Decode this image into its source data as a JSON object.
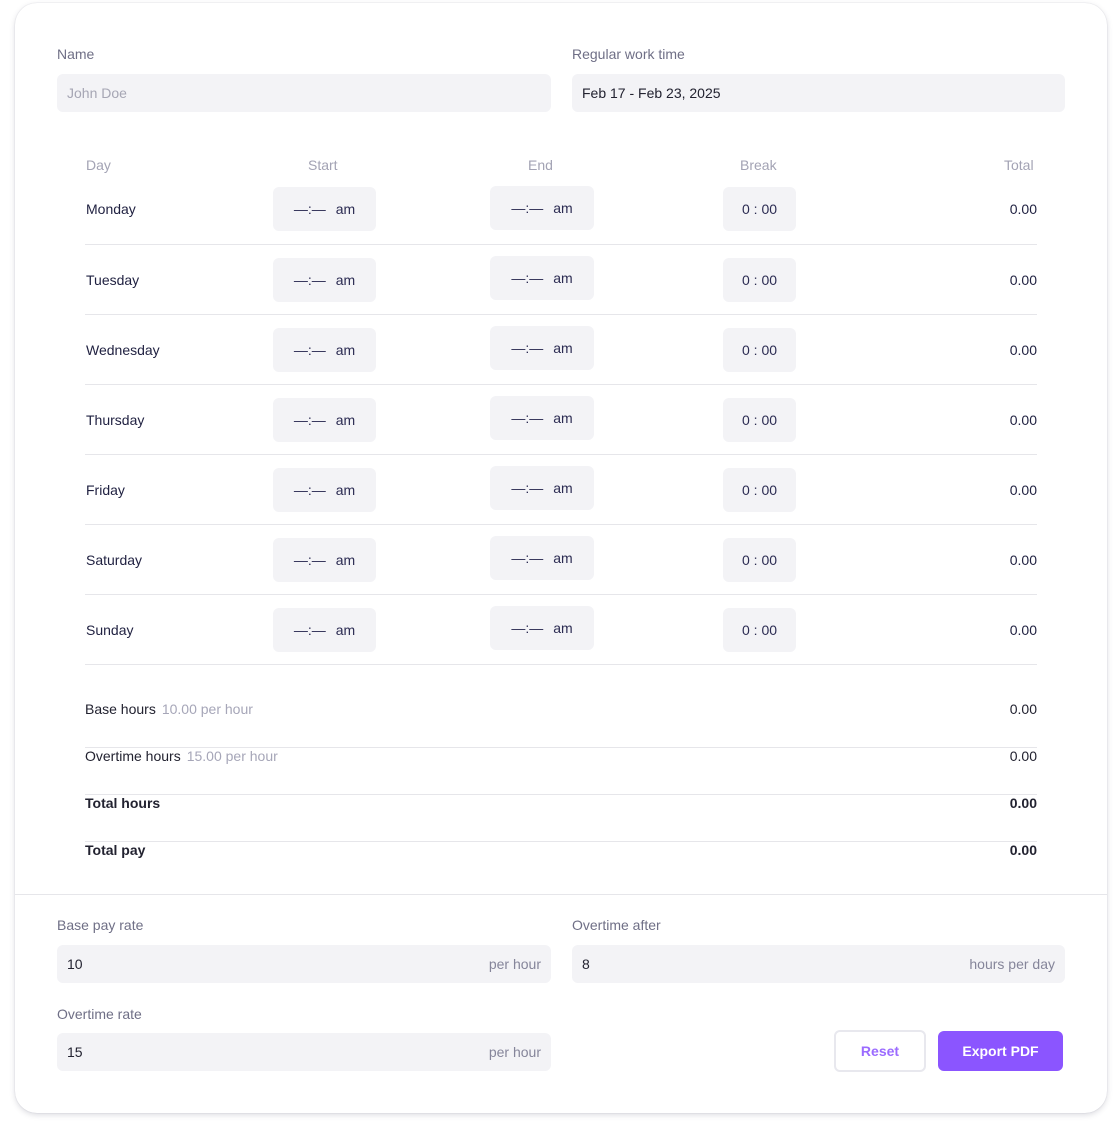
{
  "form": {
    "name": {
      "label": "Name",
      "placeholder": "John Doe",
      "value": ""
    },
    "work_time": {
      "label": "Regular work time",
      "value": "Feb 17 - Feb 23, 2025"
    }
  },
  "table": {
    "headers": {
      "day": "Day",
      "start": "Start",
      "end": "End",
      "break": "Break",
      "total": "Total"
    },
    "rows": [
      {
        "day": "Monday",
        "start_time": "—:—",
        "start_ampm": "am",
        "end_time": "—:—",
        "end_ampm": "am",
        "break": "0 : 00",
        "total": "0.00"
      },
      {
        "day": "Tuesday",
        "start_time": "—:—",
        "start_ampm": "am",
        "end_time": "—:—",
        "end_ampm": "am",
        "break": "0 : 00",
        "total": "0.00"
      },
      {
        "day": "Wednesday",
        "start_time": "—:—",
        "start_ampm": "am",
        "end_time": "—:—",
        "end_ampm": "am",
        "break": "0 : 00",
        "total": "0.00"
      },
      {
        "day": "Thursday",
        "start_time": "—:—",
        "start_ampm": "am",
        "end_time": "—:—",
        "end_ampm": "am",
        "break": "0 : 00",
        "total": "0.00"
      },
      {
        "day": "Friday",
        "start_time": "—:—",
        "start_ampm": "am",
        "end_time": "—:—",
        "end_ampm": "am",
        "break": "0 : 00",
        "total": "0.00"
      },
      {
        "day": "Saturday",
        "start_time": "—:—",
        "start_ampm": "am",
        "end_time": "—:—",
        "end_ampm": "am",
        "break": "0 : 00",
        "total": "0.00"
      },
      {
        "day": "Sunday",
        "start_time": "—:—",
        "start_ampm": "am",
        "end_time": "—:—",
        "end_ampm": "am",
        "break": "0 : 00",
        "total": "0.00"
      }
    ]
  },
  "summary": {
    "base_hours": {
      "label": "Base hours",
      "rate": "10.00 per hour",
      "value": "0.00"
    },
    "overtime_hours": {
      "label": "Overtime hours",
      "rate": "15.00 per hour",
      "value": "0.00"
    },
    "total_hours": {
      "label": "Total hours",
      "value": "0.00"
    },
    "total_pay": {
      "label": "Total pay",
      "value": "0.00"
    }
  },
  "settings": {
    "base_pay_rate": {
      "label": "Base pay rate",
      "value": "10",
      "suffix": "per hour"
    },
    "overtime_after": {
      "label": "Overtime after",
      "value": "8",
      "suffix": "hours per day"
    },
    "overtime_rate": {
      "label": "Overtime rate",
      "value": "15",
      "suffix": "per hour"
    }
  },
  "actions": {
    "reset": "Reset",
    "export": "Export PDF"
  },
  "colors": {
    "accent": "#8b55ff",
    "field_bg": "#f3f3f6",
    "border": "#e6e6ea"
  }
}
